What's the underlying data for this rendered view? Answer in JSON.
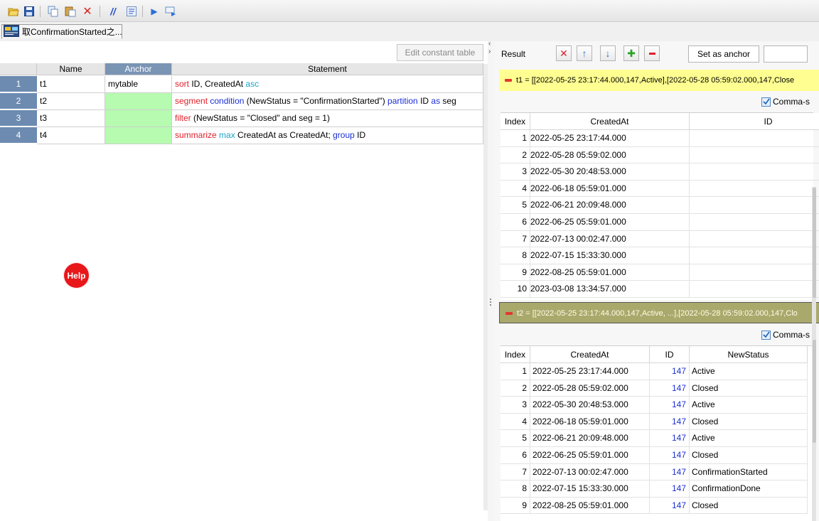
{
  "tab": {
    "label": "取ConfirmationStarted之..."
  },
  "left": {
    "edit_constant_table": "Edit constant table",
    "headers": {
      "name": "Name",
      "anchor": "Anchor",
      "statement": "Statement"
    },
    "rows": [
      {
        "num": "1",
        "name": "t1",
        "anchor": "mytable",
        "anchor_green": false
      },
      {
        "num": "2",
        "name": "t2",
        "anchor": "",
        "anchor_green": true
      },
      {
        "num": "3",
        "name": "t3",
        "anchor": "",
        "anchor_green": true
      },
      {
        "num": "4",
        "name": "t4",
        "anchor": "",
        "anchor_green": true
      }
    ],
    "statements": {
      "s1": {
        "a": "sort",
        "b": " ID, CreatedAt ",
        "c": "asc"
      },
      "s2": {
        "a": "segment",
        "b": " ",
        "c": "condition",
        "d": " (NewStatus = \"ConfirmationStarted\") ",
        "e": "partition",
        "f": " ID ",
        "g": "as",
        "h": " seg"
      },
      "s3": {
        "a": "filter",
        "b": " (NewStatus = \"Closed\" and seg = 1)"
      },
      "s4": {
        "a": "summarize",
        "b": " ",
        "c": "max",
        "d": " CreatedAt as CreatedAt; ",
        "e": "group",
        "f": " ID"
      }
    },
    "help": "Help"
  },
  "right": {
    "result_label": "Result",
    "set_anchor": "Set as anchor",
    "comma_label": "Comma-s",
    "banner1": "t1 = [[2022-05-25 23:17:44.000,147,Active],[2022-05-28 05:59:02.000,147,Close",
    "banner2": "t2 = [[2022-05-25 23:17:44.000,147,Active, ...],[2022-05-28 05:59:02.000,147,Clo",
    "table1": {
      "headers": [
        "Index",
        "CreatedAt",
        "ID"
      ],
      "rows": [
        [
          "1",
          "2022-05-25 23:17:44.000"
        ],
        [
          "2",
          "2022-05-28 05:59:02.000"
        ],
        [
          "3",
          "2022-05-30 20:48:53.000"
        ],
        [
          "4",
          "2022-06-18 05:59:01.000"
        ],
        [
          "5",
          "2022-06-21 20:09:48.000"
        ],
        [
          "6",
          "2022-06-25 05:59:01.000"
        ],
        [
          "7",
          "2022-07-13 00:02:47.000"
        ],
        [
          "8",
          "2022-07-15 15:33:30.000"
        ],
        [
          "9",
          "2022-08-25 05:59:01.000"
        ],
        [
          "10",
          "2023-03-08 13:34:57.000"
        ]
      ]
    },
    "table2": {
      "headers": [
        "Index",
        "CreatedAt",
        "ID",
        "NewStatus"
      ],
      "rows": [
        [
          "1",
          "2022-05-25 23:17:44.000",
          "147",
          "Active"
        ],
        [
          "2",
          "2022-05-28 05:59:02.000",
          "147",
          "Closed"
        ],
        [
          "3",
          "2022-05-30 20:48:53.000",
          "147",
          "Active"
        ],
        [
          "4",
          "2022-06-18 05:59:01.000",
          "147",
          "Closed"
        ],
        [
          "5",
          "2022-06-21 20:09:48.000",
          "147",
          "Active"
        ],
        [
          "6",
          "2022-06-25 05:59:01.000",
          "147",
          "Closed"
        ],
        [
          "7",
          "2022-07-13 00:02:47.000",
          "147",
          "ConfirmationStarted"
        ],
        [
          "8",
          "2022-07-15 15:33:30.000",
          "147",
          "ConfirmationDone"
        ],
        [
          "9",
          "2022-08-25 05:59:01.000",
          "147",
          "Closed"
        ]
      ]
    }
  }
}
